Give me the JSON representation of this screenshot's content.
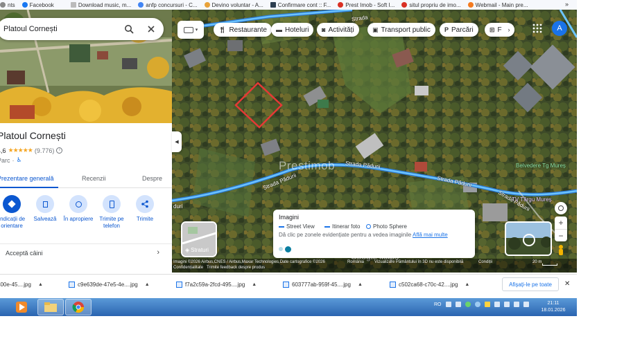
{
  "bookmarks": [
    {
      "label": "nts",
      "icon": "bookmark-icon",
      "color": "#888888"
    },
    {
      "label": "Facebook",
      "icon": "facebook-icon",
      "color": "#1877f2"
    },
    {
      "label": "Download music, m...",
      "icon": "page-icon",
      "color": "#aaaaaa"
    },
    {
      "label": "anfp concursuri - C...",
      "icon": "google-icon",
      "color": "#4285f4"
    },
    {
      "label": "Devino voluntar - A...",
      "icon": "star-icon",
      "color": "#e8a23a"
    },
    {
      "label": "Confirmare cont :: F...",
      "icon": "page-icon",
      "color": "#2c3e50"
    },
    {
      "label": "Prest Imob - Soft I...",
      "icon": "red-circle-icon",
      "color": "#d93025"
    },
    {
      "label": "situl propriu de imo...",
      "icon": "red-circle-icon",
      "color": "#d93025"
    },
    {
      "label": "Webmail - Main pre...",
      "icon": "webmail-icon",
      "color": "#f47b20"
    }
  ],
  "bookmarks_more": "»",
  "search": {
    "value": "Platoul Cornești"
  },
  "place": {
    "title": "Platoul Cornești",
    "rating": "4,6",
    "stars": "★★★★★",
    "reviews": "(9.776)",
    "category": "Parc"
  },
  "tabs": [
    {
      "label": "Prezentare generală",
      "active": true
    },
    {
      "label": "Recenzii",
      "active": false
    },
    {
      "label": "Despre",
      "active": false
    }
  ],
  "actions": [
    {
      "label": "Indicații de orientare",
      "icon": "directions-icon"
    },
    {
      "label": "Salvează",
      "icon": "bookmark-icon"
    },
    {
      "label": "În apropiere",
      "icon": "nearby-icon"
    },
    {
      "label": "Trimite pe telefon",
      "icon": "phone-icon"
    },
    {
      "label": "Trimite",
      "icon": "share-icon"
    }
  ],
  "dogs_row": "Acceptă câini",
  "chips": [
    {
      "label": "Restaurante",
      "icon": "fork-knife-icon"
    },
    {
      "label": "Hoteluri",
      "icon": "bed-icon"
    },
    {
      "label": "Activități",
      "icon": "camera-icon"
    },
    {
      "label": "Transport public",
      "icon": "bus-icon"
    },
    {
      "label": "Parcări",
      "icon": "parking-icon"
    },
    {
      "label": "F",
      "icon": "pharmacy-icon"
    }
  ],
  "avatar_letter": "A",
  "streets": [
    "Strada",
    "Strada Pădurii",
    "Strada Pădurii",
    "Strada Pădurii",
    "Strada Pădurii",
    "duri"
  ],
  "pois": {
    "belvedere": "Belvedere Tg Mureș",
    "tv": "TV Târgu Mureș"
  },
  "watermark": "Prestimob",
  "google_mark": "Google Maps",
  "layers_label": "Straturi",
  "imagery": {
    "title": "Imagini",
    "street_view": "Street View",
    "itinerar": "Itinerar foto",
    "photo_sphere": "Photo Sphere",
    "description": "Dă clic pe zonele evidențiate pentru a vedea imaginile",
    "learn_more": "Află mai multe"
  },
  "attribution": {
    "imagery": "Imagini ©2026 Airbus,CNES / Airbus,Maxar Technologies,Date cartografice ©2026",
    "privacy": "Confidențialitate",
    "feedback": "Trimite feedback despre produs",
    "country": "România",
    "terrain": "Vizualizare Pământului în 3D nu este disponibilă",
    "terms": "Condiții",
    "scale": "20 m"
  },
  "downloads": [
    "400e-45....jpg",
    "c9e639de-47e5-4e....jpg",
    "f7a2c59a-2fcd-495....jpg",
    "603777ab-959f-45....jpg",
    "c502ca68-c70c-42....jpg"
  ],
  "downloads_show_all": "Afișați-le pe toate",
  "taskbar": {
    "lang": "RO",
    "time": "21:11",
    "date": "18.01.2026"
  },
  "colors": {
    "accent": "#0b57d0",
    "road": "#5fb5f5",
    "marker": "#e53935"
  }
}
